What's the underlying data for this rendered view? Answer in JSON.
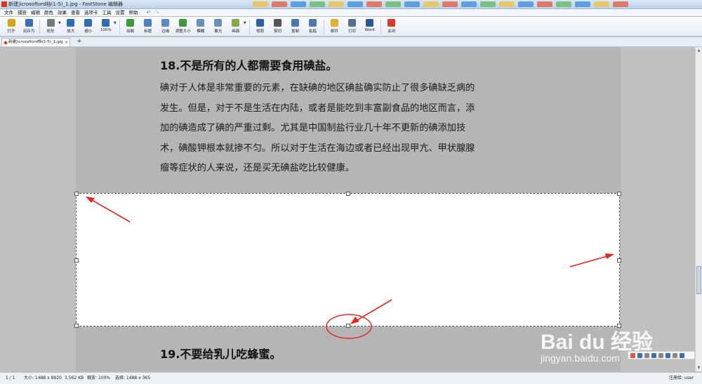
{
  "window": {
    "title": "新建|icrosoftord档(1-5)_1.jpg - FastStone 编辑器"
  },
  "menu": [
    "文件",
    "捕获",
    "编辑",
    "颜色",
    "效果",
    "查看",
    "选项卡",
    "工具",
    "设置",
    "帮助"
  ],
  "toolbar": [
    {
      "label": "打开",
      "color": "#d8a21d",
      "icon": "open-folder-icon"
    },
    {
      "label": "另存为",
      "color": "#3a6fb5",
      "icon": "save-icon"
    },
    {
      "label": "矩形",
      "color": "#777777",
      "icon": "rect-select-icon"
    },
    {
      "label": "放大",
      "color": "#2f6db3",
      "icon": "zoom-in-icon"
    },
    {
      "label": "缩小",
      "color": "#2f6db3",
      "icon": "zoom-out-icon"
    },
    {
      "label": "100%",
      "color": "#2f6db3",
      "icon": "zoom-100-icon"
    },
    {
      "label": "绘制",
      "color": "#3c9a3c",
      "icon": "draw-icon"
    },
    {
      "label": "标题",
      "color": "#4f7fbf",
      "icon": "caption-icon"
    },
    {
      "label": "边缘",
      "color": "#5a8ac6",
      "icon": "edge-icon"
    },
    {
      "label": "调整大小",
      "color": "#3c9a3c",
      "icon": "resize-icon"
    },
    {
      "label": "模糊",
      "color": "#6b8fbd",
      "icon": "blur-icon"
    },
    {
      "label": "聚光",
      "color": "#6b8fbd",
      "icon": "spotlight-icon"
    },
    {
      "label": "画面",
      "color": "#8aa84a",
      "icon": "canvas-icon"
    },
    {
      "label": "修剪",
      "color": "#2f5f9f",
      "icon": "crop-icon"
    },
    {
      "label": "剪切",
      "color": "#555555",
      "icon": "cut-icon"
    },
    {
      "label": "复制",
      "color": "#4d78ad",
      "icon": "copy-icon"
    },
    {
      "label": "粘贴",
      "color": "#4d78ad",
      "icon": "paste-icon"
    },
    {
      "label": "邮件",
      "color": "#e0b030",
      "icon": "mail-icon"
    },
    {
      "label": "打印",
      "color": "#5a6f8a",
      "icon": "print-icon"
    },
    {
      "label": "Word",
      "color": "#2b5797",
      "icon": "word-icon"
    },
    {
      "label": "关闭",
      "color": "#d83b2b",
      "icon": "power-icon"
    }
  ],
  "tab": {
    "name": "新建|icrosoftord档(1-5)_1.jpg",
    "close": "×",
    "add": "+"
  },
  "document": {
    "heading18": "18.不是所有的人都需要食用碘盐。",
    "para_lines": [
      "碘对于人体是非常重要的元素，在缺碘的地区碘盐确实防止了很多碘缺乏病的",
      "发生。但是，对于不是生活在内陆，或者是能吃到丰富副食品的地区而言，添",
      "加的碘造成了碘的严重过剩。尤其是中国制盐行业几十年不更新的碘添加技",
      "术，碘酸钾根本就掺不匀。所以对于生活在海边或者已经出现甲亢、甲状腺腺",
      "瘤等症状的人来说，还是买无碘盐吃比较健康。"
    ],
    "heading19": "19.不要给乳儿吃蜂蜜。"
  },
  "annotations": {
    "color": "#e8251f"
  },
  "status": {
    "page": "1 / 1",
    "size": "大小: 1488 x 8920",
    "filesize": "3,562 KB",
    "zoom": "缩放: 100%",
    "selection": "选择: 1488 x 365",
    "user": "注册给: user"
  },
  "watermark": {
    "brand": "Bai du 经验",
    "url": "jingyan.baidu.com"
  }
}
